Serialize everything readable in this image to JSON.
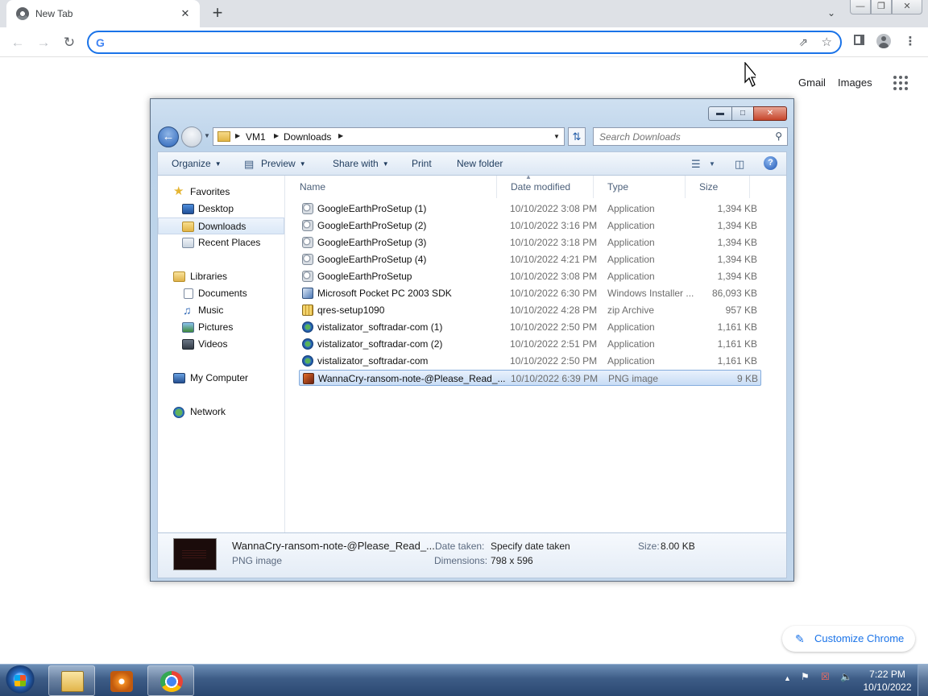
{
  "browser": {
    "tab_title": "New Tab",
    "tab_close": "✕",
    "new_tab": "+",
    "omnibox_value": "",
    "links": {
      "gmail": "Gmail",
      "images": "Images"
    },
    "customize_label": "Customize Chrome",
    "accent_color": "#1a73e8"
  },
  "explorer": {
    "breadcrumb": [
      "VM1",
      "Downloads"
    ],
    "search_placeholder": "Search Downloads",
    "commands": {
      "organize": "Organize",
      "preview": "Preview",
      "share_with": "Share with",
      "print": "Print",
      "new_folder": "New folder"
    },
    "nav": {
      "favorites": "Favorites",
      "desktop": "Desktop",
      "downloads": "Downloads",
      "recent_places": "Recent Places",
      "libraries": "Libraries",
      "documents": "Documents",
      "music": "Music",
      "pictures": "Pictures",
      "videos": "Videos",
      "my_computer": "My Computer",
      "network": "Network"
    },
    "columns": {
      "name": "Name",
      "date": "Date modified",
      "type": "Type",
      "size": "Size"
    },
    "files": [
      {
        "name": "GoogleEarthProSetup (1)",
        "date": "10/10/2022 3:08 PM",
        "type": "Application",
        "size": "1,394 KB",
        "icon": "application-icon"
      },
      {
        "name": "GoogleEarthProSetup (2)",
        "date": "10/10/2022 3:16 PM",
        "type": "Application",
        "size": "1,394 KB",
        "icon": "application-icon"
      },
      {
        "name": "GoogleEarthProSetup (3)",
        "date": "10/10/2022 3:18 PM",
        "type": "Application",
        "size": "1,394 KB",
        "icon": "application-icon"
      },
      {
        "name": "GoogleEarthProSetup (4)",
        "date": "10/10/2022 4:21 PM",
        "type": "Application",
        "size": "1,394 KB",
        "icon": "application-icon"
      },
      {
        "name": "GoogleEarthProSetup",
        "date": "10/10/2022 3:08 PM",
        "type": "Application",
        "size": "1,394 KB",
        "icon": "application-icon"
      },
      {
        "name": "Microsoft Pocket PC 2003 SDK",
        "date": "10/10/2022 6:30 PM",
        "type": "Windows Installer ...",
        "size": "86,093 KB",
        "icon": "installer-icon"
      },
      {
        "name": "qres-setup1090",
        "date": "10/10/2022 4:28 PM",
        "type": "zip Archive",
        "size": "957 KB",
        "icon": "zip-icon"
      },
      {
        "name": "vistalizator_softradar-com (1)",
        "date": "10/10/2022 2:50 PM",
        "type": "Application",
        "size": "1,161 KB",
        "icon": "globe-app-icon"
      },
      {
        "name": "vistalizator_softradar-com (2)",
        "date": "10/10/2022 2:51 PM",
        "type": "Application",
        "size": "1,161 KB",
        "icon": "globe-app-icon"
      },
      {
        "name": "vistalizator_softradar-com",
        "date": "10/10/2022 2:50 PM",
        "type": "Application",
        "size": "1,161 KB",
        "icon": "globe-app-icon"
      },
      {
        "name": "WannaCry-ransom-note-@Please_Read_...",
        "date": "10/10/2022 6:39 PM",
        "type": "PNG image",
        "size": "9 KB",
        "icon": "png-image-icon",
        "selected": true
      }
    ],
    "details": {
      "filename": "WannaCry-ransom-note-@Please_Read_...",
      "filetype": "PNG image",
      "date_taken_label": "Date taken:",
      "date_taken_value": "Specify date taken",
      "dimensions_label": "Dimensions:",
      "dimensions_value": "798 x 596",
      "size_label": "Size:",
      "size_value": "8.00 KB"
    }
  },
  "taskbar": {
    "clock_time": "7:22 PM",
    "clock_date": "10/10/2022"
  }
}
